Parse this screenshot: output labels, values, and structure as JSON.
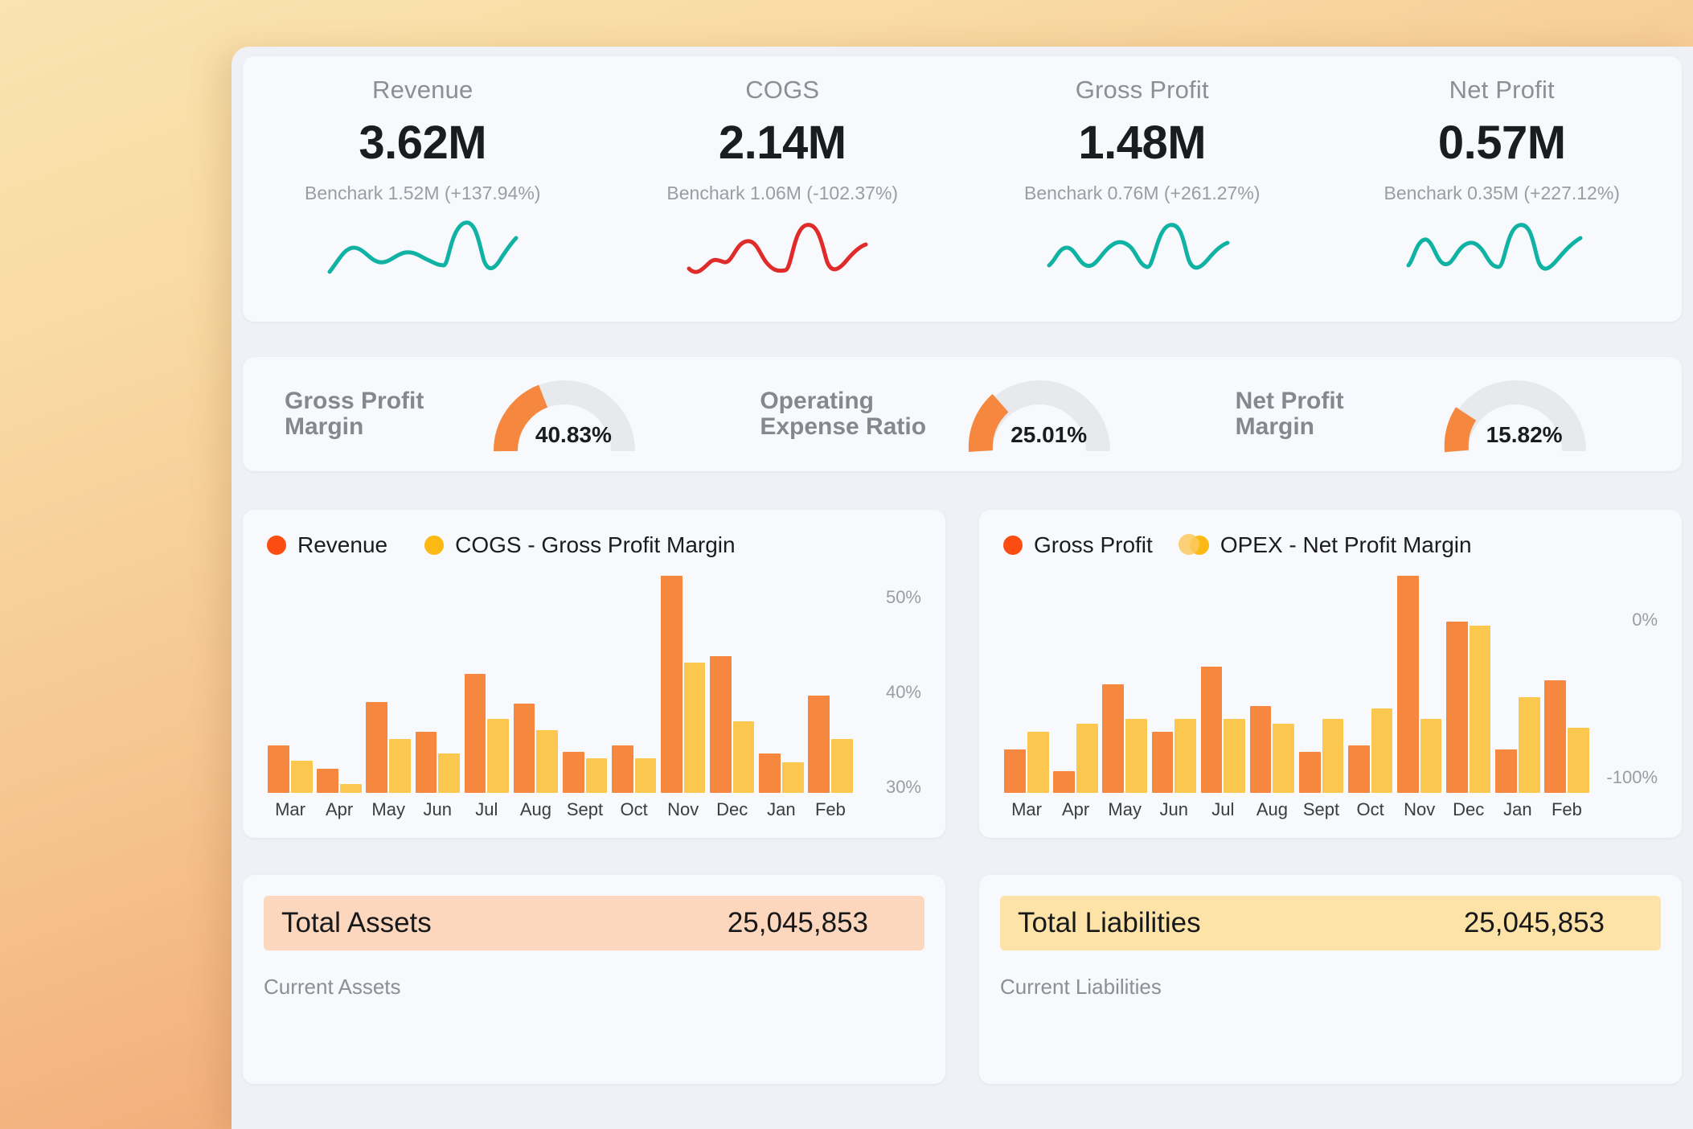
{
  "colors": {
    "primary_orange": "#f5873f",
    "secondary_yellow": "#fbc74f",
    "legend_red": "#fb4d12",
    "legend_amber": "#fcb913",
    "spark_teal": "#10b3a3",
    "spark_red": "#e02b2b",
    "gauge_track": "#e8e9ec",
    "assets_band": "#fcd7bd",
    "liabilities_band": "#fde3a7"
  },
  "kpis": [
    {
      "title": "Revenue",
      "value": "3.62M",
      "benchmark": "Benchark 1.52M (+137.94%)",
      "spark_color": "#10b3a3"
    },
    {
      "title": "COGS",
      "value": "2.14M",
      "benchmark": "Benchark 1.06M (-102.37%)",
      "spark_color": "#e02b2b"
    },
    {
      "title": "Gross Profit",
      "value": "1.48M",
      "benchmark": "Benchark 0.76M (+261.27%)",
      "spark_color": "#10b3a3"
    },
    {
      "title": "Net Profit",
      "value": "0.57M",
      "benchmark": "Benchark 0.35M (+227.12%)",
      "spark_color": "#10b3a3"
    }
  ],
  "gauges": [
    {
      "label": "Gross Profit Margin",
      "value": "40.83%",
      "fraction": 0.4083
    },
    {
      "label": "Operating Expense Ratio",
      "value": "25.01%",
      "fraction": 0.2501
    },
    {
      "label": "Net Profit Margin",
      "value": "15.82%",
      "fraction": 0.1582
    }
  ],
  "chart_data": [
    {
      "type": "bar",
      "title": "",
      "id": "revenue-cogs-chart",
      "legend": [
        {
          "label": "Revenue",
          "color": "#fb4d12"
        },
        {
          "label": "COGS - Gross Profit Margin",
          "color": "#fcb913"
        }
      ],
      "legend_position": "top-left",
      "categories": [
        "Mar",
        "Apr",
        "May",
        "Jun",
        "Jul",
        "Aug",
        "Sept",
        "Oct",
        "Nov",
        "Dec",
        "Jan",
        "Feb"
      ],
      "series": [
        {
          "name": "Revenue",
          "color": "#f5873f",
          "values": [
            22,
            11,
            42,
            28,
            55,
            41,
            19,
            22,
            100,
            63,
            18,
            45
          ]
        },
        {
          "name": "COGS",
          "color": "#fbc74f",
          "values": [
            15,
            4,
            25,
            18,
            34,
            29,
            16,
            16,
            60,
            33,
            14,
            25
          ]
        }
      ],
      "ylabel": "",
      "xlabel": "",
      "yticks": [
        "50%",
        "40%",
        "30%"
      ],
      "ylim": [
        28,
        52
      ],
      "grid": false,
      "axis_side": "right"
    },
    {
      "type": "bar",
      "title": "",
      "id": "grossprofit-opex-chart",
      "legend": [
        {
          "label": "Gross Profit",
          "color": "#fb4d12"
        },
        {
          "label": "OPEX - Net Profit Margin",
          "color": "#fcb913"
        }
      ],
      "legend_position": "top-left",
      "categories": [
        "Mar",
        "Apr",
        "May",
        "Jun",
        "Jul",
        "Aug",
        "Sept",
        "Oct",
        "Nov",
        "Dec",
        "Jan",
        "Feb"
      ],
      "series": [
        {
          "name": "Gross Profit",
          "color": "#f5873f",
          "values": [
            20,
            10,
            50,
            28,
            58,
            40,
            19,
            22,
            100,
            79,
            20,
            52
          ]
        },
        {
          "name": "OPEX",
          "color": "#fbc74f",
          "values": [
            28,
            32,
            34,
            34,
            34,
            32,
            34,
            39,
            34,
            77,
            44,
            30
          ]
        }
      ],
      "ylabel": "",
      "xlabel": "",
      "yticks": [
        "0%",
        "-100%"
      ],
      "ylim": [
        -100,
        0
      ],
      "grid": false,
      "axis_side": "right"
    }
  ],
  "balance": [
    {
      "total_label": "Total Assets",
      "total_value": "25,045,853",
      "sub_label": "Current Assets",
      "band": "assets"
    },
    {
      "total_label": "Total Liabilities",
      "total_value": "25,045,853",
      "sub_label": "Current Liabilities",
      "band": "liabilities"
    }
  ]
}
